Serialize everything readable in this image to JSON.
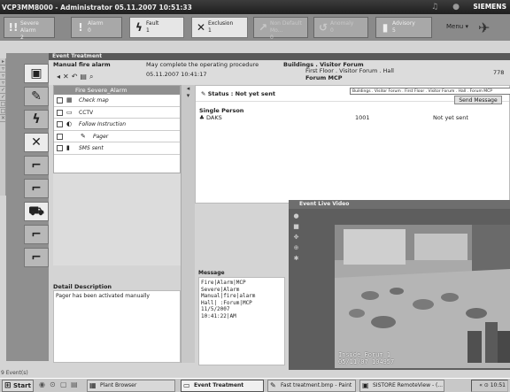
{
  "titlebar": {
    "title": "VCP3MM8000 - Administrator   05.11.2007 10:51:33",
    "brand": "SIEMENS",
    "icons": [
      "bell-icon",
      "globe-icon"
    ]
  },
  "alarm_toolbar": {
    "buttons": [
      {
        "label": "Severe Alarm",
        "count": "2",
        "icon": "severe-alarm-icon"
      },
      {
        "label": "Alarm",
        "count": "0",
        "icon": "alarm-icon"
      },
      {
        "label": "Fault",
        "count": "1",
        "icon": "fault-icon"
      },
      {
        "label": "Exclusion",
        "count": "1",
        "icon": "exclusion-icon"
      },
      {
        "label": "Non Default Mo...",
        "count": "0",
        "icon": "non-default-icon"
      },
      {
        "label": "Anomaly",
        "count": "0",
        "icon": "anomaly-icon"
      },
      {
        "label": "Advisory",
        "count": "5",
        "icon": "advisory-icon"
      }
    ],
    "menu_label": "Menu ▾"
  },
  "event": {
    "header": "Event Treatment",
    "type": "Manual fire alarm",
    "instruction": "May complete the operating procedure",
    "datetime": "05.11.2007  10:41:17",
    "location_label": "Buildings . Visitor Forum",
    "location_line2": "First Floor . Visitor Forum . Hall",
    "location_line3": "Forum MCP",
    "location_code": "778"
  },
  "procedure": {
    "title": "Fire Severe_Alarm",
    "steps": [
      {
        "label": "Check map",
        "icon": "map-icon",
        "italic": true
      },
      {
        "label": "CCTV",
        "icon": "camera-icon",
        "italic": false
      },
      {
        "label": "Follow Instruction",
        "icon": "instruction-icon",
        "italic": true
      },
      {
        "label": "Pager",
        "icon": "pager-icon",
        "italic": true
      },
      {
        "label": "SMS sent",
        "icon": "phone-icon",
        "italic": true
      }
    ]
  },
  "detail": {
    "title": "Detail Description",
    "text": "Pager has been activated manually"
  },
  "status": {
    "label": "Status : Not yet sent",
    "path_tooltip": "Buildings . Visitor Forum . First Floor . Visitor Forum . Hall . Forum MCP",
    "send_button": "Send Message",
    "single_person_title": "Single Person",
    "person": {
      "name": "DAKS",
      "number": "1001",
      "state": "Not yet sent"
    }
  },
  "message": {
    "title": "Message",
    "text": "Fire|Alarm|MCP\nSevere|Alarm\nManual|fire|alarm\nHall| :Forum|MCP\n11/5/2007\n10:41:22|AM"
  },
  "video": {
    "title": "Event Live Video",
    "caption_line1": "Inside Forum 1",
    "caption_line2": "05/11/07 104957"
  },
  "status_footer": "9 Event(s)",
  "taskbar": {
    "start": "Start",
    "items": [
      {
        "label": "Plant Browser",
        "icon": "folder-icon"
      },
      {
        "label": "Event Treatment",
        "icon": "window-icon"
      },
      {
        "label": "Fast treatment.bmp - Paint",
        "icon": "paint-icon"
      },
      {
        "label": "SISTORE RemoteView - (...",
        "icon": "remoteview-icon"
      }
    ],
    "clock": "10:51"
  }
}
